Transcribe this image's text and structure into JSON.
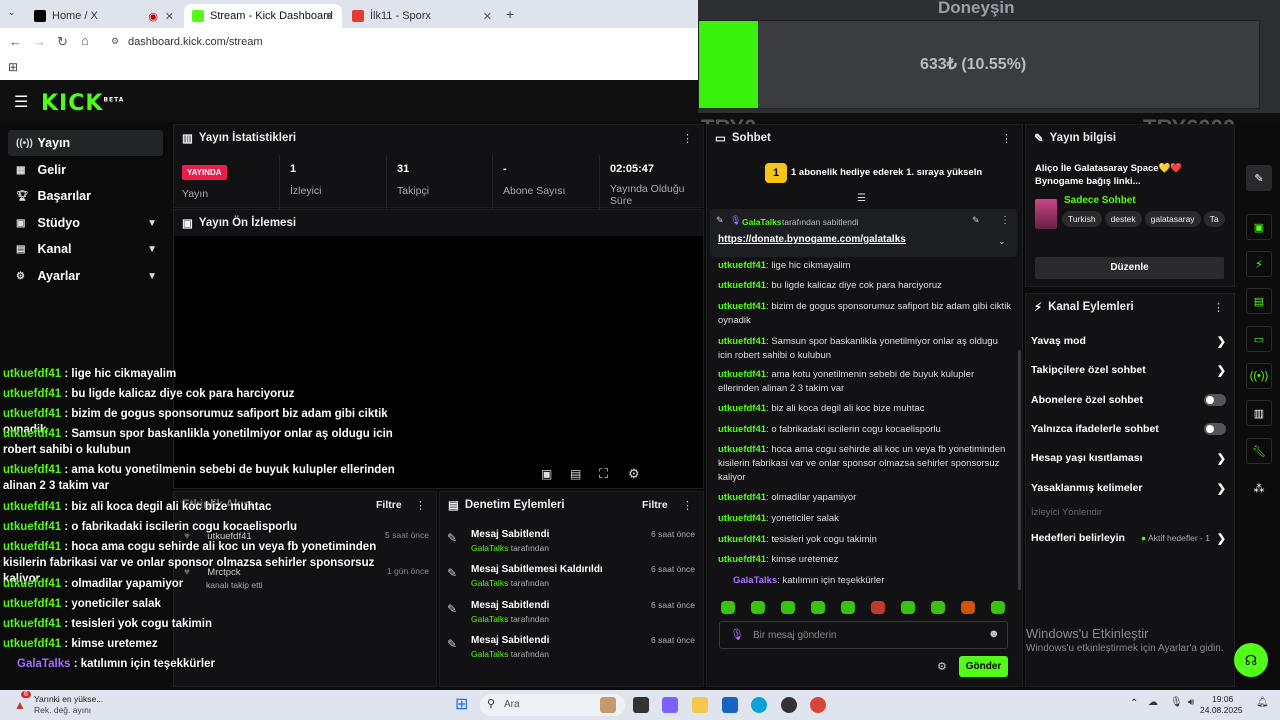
{
  "browser": {
    "tabs": [
      {
        "label": "Home / X",
        "icon": "x-logo-icon"
      },
      {
        "label": "Stream - Kick Dashboard",
        "icon": "kick-logo-icon"
      },
      {
        "label": "İlk11 - Sporx",
        "icon": "sporx-icon"
      }
    ],
    "url": "dashboard.kick.com/stream"
  },
  "overlay_widget": {
    "title": "Doneyşin",
    "amount": "633₺ (10.55%)",
    "goal_left": "TRY0",
    "goal_right": "TRY6000",
    "progress_percent": 10.55
  },
  "sidebar": {
    "items": [
      {
        "label": "Yayın",
        "icon": "broadcast-icon"
      },
      {
        "label": "Gelir",
        "icon": "revenue-icon"
      },
      {
        "label": "Başarılar",
        "icon": "trophy-icon"
      },
      {
        "label": "Stüdyo",
        "icon": "studio-icon"
      },
      {
        "label": "Kanal",
        "icon": "channel-icon"
      },
      {
        "label": "Ayarlar",
        "icon": "gear-icon"
      }
    ]
  },
  "stats": {
    "title": "Yayın İstatistikleri",
    "live_badge": "YAYINDA",
    "live_label": "Yayın",
    "items": [
      {
        "value": "1",
        "label": "İzleyici"
      },
      {
        "value": "31",
        "label": "Takipçi"
      },
      {
        "value": "-",
        "label": "Abone Sayısı"
      },
      {
        "value": "02:05:47",
        "label": "Yayında Olduğu Süre"
      }
    ]
  },
  "preview": {
    "title": "Yayın Ön İzlemesi"
  },
  "activity": {
    "title": "Etkinlik Akışı",
    "filter": "Filtre",
    "items": [
      {
        "user": "utkuefdf41",
        "time": "5 saat önce",
        "text": ""
      },
      {
        "user": "Mrctpck",
        "time": "1 gün önce",
        "text": "kanalı takip etti"
      }
    ]
  },
  "moderation": {
    "title": "Denetim Eylemleri",
    "filter": "Filtre",
    "by_label": "tarafından",
    "items": [
      {
        "action": "Mesaj Sabitlendi",
        "by": "GalaTalks",
        "time": "6 saat önce"
      },
      {
        "action": "Mesaj Sabitlemesi Kaldırıldı",
        "by": "GalaTalks",
        "time": "6 saat önce"
      },
      {
        "action": "Mesaj Sabitlendi",
        "by": "GalaTalks",
        "time": "6 saat önce"
      },
      {
        "action": "Mesaj Sabitlendi",
        "by": "GalaTalks",
        "time": "6 saat önce"
      }
    ]
  },
  "chat": {
    "title": "Sohbet",
    "sub_gift_banner": "1 abonelik hediye ederek 1. sıraya yükseln",
    "pinned_by": "GalaTalks",
    "pinned_suffix": "tarafından sabitlendi",
    "pinned_link": "https://donate.bynogame.com/galatalks",
    "messages": [
      {
        "user": "utkuefdf41",
        "text": "lige hic cikmayalim"
      },
      {
        "user": "utkuefdf41",
        "text": "bu ligde kalicaz diye cok para harciyoruz"
      },
      {
        "user": "utkuefdf41",
        "text": "bizim de gogus sponsorumuz safiport biz adam gibi ciktik oynadik"
      },
      {
        "user": "utkuefdf41",
        "text": "Samsun spor baskanlikla yonetilmiyor onlar aş oldugu icin robert sahibi o kulubun"
      },
      {
        "user": "utkuefdf41",
        "text": "ama kotu yonetilmenin sebebi de buyuk kulupler ellerinden alinan 2 3 takim var"
      },
      {
        "user": "utkuefdf41",
        "text": "biz ali koca degil ali koc bize muhtac"
      },
      {
        "user": "utkuefdf41",
        "text": "o fabrikadaki iscilerin cogu kocaelisporlu"
      },
      {
        "user": "utkuefdf41",
        "text": "hoca ama cogu sehirde ali koc un veya fb yonetiminden kisilerin fabrikasi var ve onlar sponsor olmazsa sehirler sponsorsuz kaliyor"
      },
      {
        "user": "utkuefdf41",
        "text": "olmadilar yapamiyor"
      },
      {
        "user": "utkuefdf41",
        "text": "yoneticiler salak"
      },
      {
        "user": "utkuefdf41",
        "text": "tesisleri yok cogu takimin"
      },
      {
        "user": "utkuefdf41",
        "text": "kimse uretemez"
      },
      {
        "user": "GalaTalks",
        "text": "katılımın için teşekkürler"
      }
    ],
    "input_placeholder": "Bir mesaj gönderin",
    "send_label": "Gönder"
  },
  "stream_info": {
    "title": "Yayın bilgisi",
    "stream_title": "Aliço İle Galatasaray Space💛❤️ Bynogame bağış linki...",
    "category": "Sadece Sohbet",
    "tags": [
      "Turkish",
      "destek",
      "galatasaray",
      "Ta"
    ],
    "edit_label": "Düzenle"
  },
  "channel_actions": {
    "title": "Kanal Eylemleri",
    "items": [
      {
        "label": "Yavaş mod",
        "type": "chevron"
      },
      {
        "label": "Takipçilere özel sohbet",
        "type": "chevron"
      },
      {
        "label": "Abonelere özel sohbet",
        "type": "toggle"
      },
      {
        "label": "Yalnızca ifadelerle sohbet",
        "type": "toggle"
      },
      {
        "label": "Hesap yaşı kısıtlaması",
        "type": "chevron"
      },
      {
        "label": "Yasaklanmış kelimeler",
        "type": "chevron"
      }
    ],
    "viewer_redirect": "İzleyici Yönlendir",
    "goals_label": "Hedefleri belirleyin",
    "goals_status": "Aktif hedefler - 1"
  },
  "windows_activation": {
    "title": "Windows'u Etkinleştir",
    "subtitle": "Windows'u etkinleştirmek için Ayarlar'a gidin."
  },
  "taskbar": {
    "weather_title": "Yarınki en yükse...",
    "weather_sub": "Rek. değ. ayını",
    "badge_count": "6",
    "search_placeholder": "Ara",
    "time": "19:06",
    "date": "24.08.2025"
  },
  "colors": {
    "kick_green": "#53fc18",
    "live_red": "#e91e4a",
    "sub_purple": "#a970ff"
  }
}
